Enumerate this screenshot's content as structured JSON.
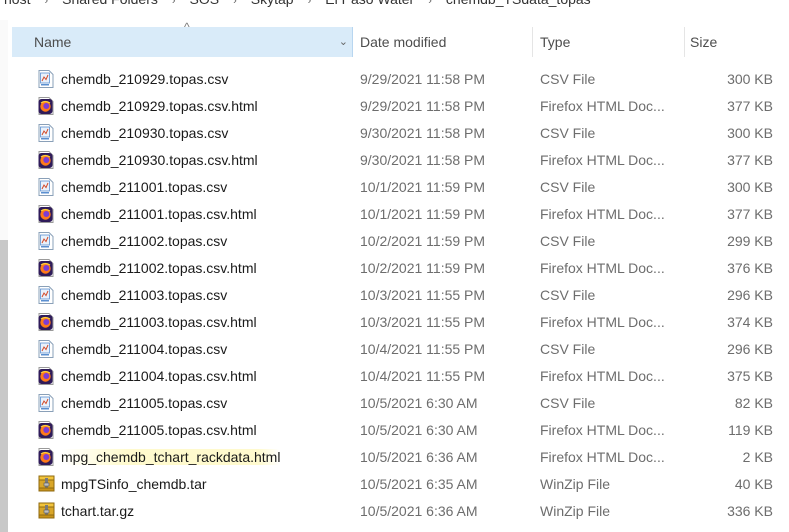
{
  "breadcrumb": [
    "host",
    "Shared Folders",
    "SOS",
    "Skytap",
    "El Paso Water",
    "chemdb_TSdata_topas"
  ],
  "columns": {
    "name": "Name",
    "date": "Date modified",
    "type": "Type",
    "size": "Size"
  },
  "files": [
    {
      "name": "chemdb_210929.topas.csv",
      "date": "9/29/2021 11:58 PM",
      "type": "CSV File",
      "size": "300 KB",
      "icon": "csv-file-icon"
    },
    {
      "name": "chemdb_210929.topas.csv.html",
      "date": "9/29/2021 11:58 PM",
      "type": "Firefox HTML Doc...",
      "size": "377 KB",
      "icon": "firefox-html-icon"
    },
    {
      "name": "chemdb_210930.topas.csv",
      "date": "9/30/2021 11:58 PM",
      "type": "CSV File",
      "size": "300 KB",
      "icon": "csv-file-icon"
    },
    {
      "name": "chemdb_210930.topas.csv.html",
      "date": "9/30/2021 11:58 PM",
      "type": "Firefox HTML Doc...",
      "size": "377 KB",
      "icon": "firefox-html-icon"
    },
    {
      "name": "chemdb_211001.topas.csv",
      "date": "10/1/2021 11:59 PM",
      "type": "CSV File",
      "size": "300 KB",
      "icon": "csv-file-icon"
    },
    {
      "name": "chemdb_211001.topas.csv.html",
      "date": "10/1/2021 11:59 PM",
      "type": "Firefox HTML Doc...",
      "size": "377 KB",
      "icon": "firefox-html-icon"
    },
    {
      "name": "chemdb_211002.topas.csv",
      "date": "10/2/2021 11:59 PM",
      "type": "CSV File",
      "size": "299 KB",
      "icon": "csv-file-icon"
    },
    {
      "name": "chemdb_211002.topas.csv.html",
      "date": "10/2/2021 11:59 PM",
      "type": "Firefox HTML Doc...",
      "size": "376 KB",
      "icon": "firefox-html-icon"
    },
    {
      "name": "chemdb_211003.topas.csv",
      "date": "10/3/2021 11:55 PM",
      "type": "CSV File",
      "size": "296 KB",
      "icon": "csv-file-icon"
    },
    {
      "name": "chemdb_211003.topas.csv.html",
      "date": "10/3/2021 11:55 PM",
      "type": "Firefox HTML Doc...",
      "size": "374 KB",
      "icon": "firefox-html-icon"
    },
    {
      "name": "chemdb_211004.topas.csv",
      "date": "10/4/2021 11:55 PM",
      "type": "CSV File",
      "size": "296 KB",
      "icon": "csv-file-icon"
    },
    {
      "name": "chemdb_211004.topas.csv.html",
      "date": "10/4/2021 11:55 PM",
      "type": "Firefox HTML Doc...",
      "size": "375 KB",
      "icon": "firefox-html-icon"
    },
    {
      "name": "chemdb_211005.topas.csv",
      "date": "10/5/2021 6:30 AM",
      "type": "CSV File",
      "size": "82 KB",
      "icon": "csv-file-icon"
    },
    {
      "name": "chemdb_211005.topas.csv.html",
      "date": "10/5/2021 6:30 AM",
      "type": "Firefox HTML Doc...",
      "size": "119 KB",
      "icon": "firefox-html-icon"
    },
    {
      "name": "mpg_chemdb_tchart_rackdata.html",
      "date": "10/5/2021 6:36 AM",
      "type": "Firefox HTML Doc...",
      "size": "2 KB",
      "icon": "firefox-html-icon",
      "highlight": true
    },
    {
      "name": "mpgTSinfo_chemdb.tar",
      "date": "10/5/2021 6:35 AM",
      "type": "WinZip File",
      "size": "40 KB",
      "icon": "winzip-archive-icon"
    },
    {
      "name": "tchart.tar.gz",
      "date": "10/5/2021 6:36 AM",
      "type": "WinZip File",
      "size": "336 KB",
      "icon": "winzip-archive-icon"
    }
  ]
}
